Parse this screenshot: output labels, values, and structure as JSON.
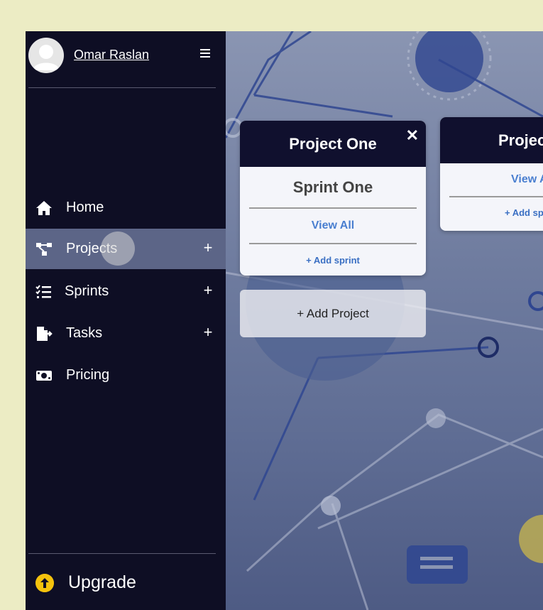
{
  "user": {
    "name": "Omar Raslan"
  },
  "sidebar": {
    "items": [
      {
        "label": "Home",
        "icon": "home-icon",
        "has_add": false,
        "active": false
      },
      {
        "label": "Projects",
        "icon": "projects-icon",
        "has_add": true,
        "active": true
      },
      {
        "label": "Sprints",
        "icon": "sprints-icon",
        "has_add": true,
        "active": false
      },
      {
        "label": "Tasks",
        "icon": "tasks-icon",
        "has_add": true,
        "active": false
      },
      {
        "label": "Pricing",
        "icon": "pricing-icon",
        "has_add": false,
        "active": false
      }
    ],
    "add_symbol": "+",
    "upgrade_label": "Upgrade"
  },
  "projects": [
    {
      "title": "Project One",
      "sprint": "Sprint One",
      "view_all": "View All",
      "add_sprint": "+ Add sprint",
      "close": "✕"
    },
    {
      "title": "Project Two",
      "view_all": "View All",
      "add_sprint": "+ Add sprint"
    }
  ],
  "add_project_label": "+ Add Project",
  "colors": {
    "page_bg": "#ececc4",
    "sidebar_bg": "#0e0e24",
    "active_item": "#5c6587",
    "card_header": "#10102e",
    "link": "#4a7fd0",
    "upgrade": "#f4c20d"
  }
}
